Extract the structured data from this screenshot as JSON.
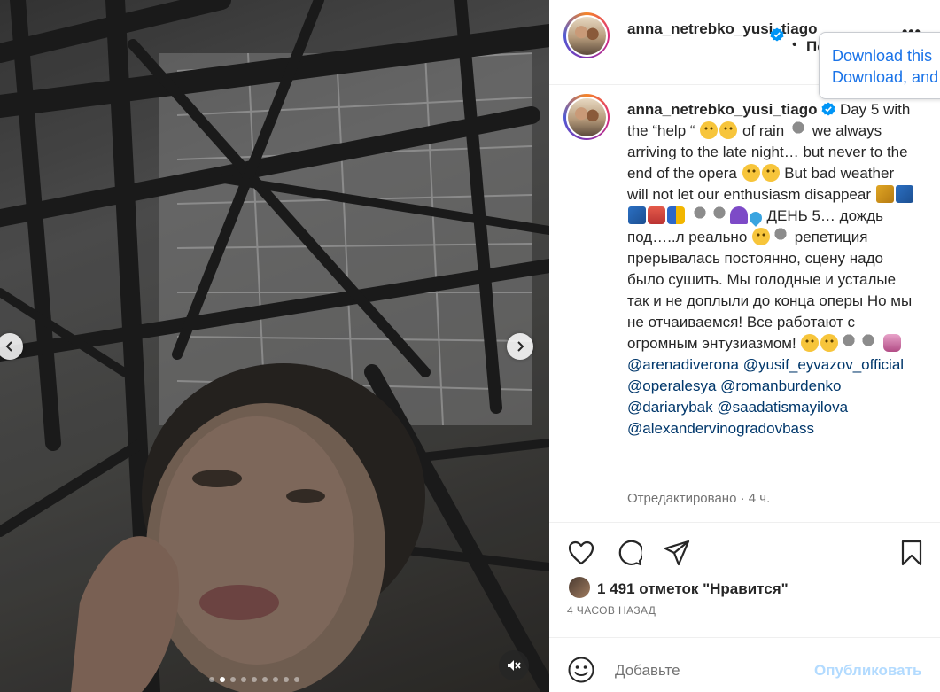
{
  "post": {
    "username": "anna_netrebko_yusi_tiago",
    "header_bullet": "•",
    "follow_label": "Подписки",
    "more_label": "•••"
  },
  "download_popup": {
    "line1": "Download this",
    "line2": "Download, and"
  },
  "caption": {
    "author": "anna_netrebko_yusi_tiago",
    "seg1": "Day 5 with the “help “",
    "seg2": "of rain",
    "seg3": "we always arriving to the late night… but never to the end of the opera",
    "seg4": "But bad weather will not let our enthusiasm disappear",
    "seg5": "ДЕНЬ 5… дождь под…..л реально",
    "seg6": "репетиция прерывалась постоянно, сцену надо было сушить. Мы голодные и усталые так и не доплыли до конца оперы Но мы не отчаиваемся! Все работают с огромным энтузиазмом!",
    "mentions": [
      "@arenadiverona",
      "@yusif_eyvazov_official",
      "@operalesya",
      "@romanburdenko",
      "@dariarybak",
      "@saadatismayilova",
      "@alexandervinogradovbass"
    ],
    "edited": "Отредактировано · 4 ч."
  },
  "likes": {
    "text": "1 491 отметок \"Нравится\"",
    "time_ago": "4 ЧАСОВ НАЗАД"
  },
  "comment": {
    "placeholder": "Добавьте",
    "publish_label": "Опубликовать"
  },
  "carousel": {
    "total_slides": 9,
    "active_slide": 2
  },
  "icons": {
    "heart": "heart-icon",
    "comment": "comment-icon",
    "share": "share-icon",
    "save": "bookmark-icon",
    "emoji": "emoji-icon",
    "mute": "volume-muted-icon",
    "prev": "chevron-left-icon",
    "next": "chevron-right-icon",
    "verified": "verified-badge-icon"
  },
  "colors": {
    "link": "#00376b",
    "verified": "#0095f6",
    "publish_disabled": "#b3dbff",
    "popup_text": "#1a73e8"
  }
}
